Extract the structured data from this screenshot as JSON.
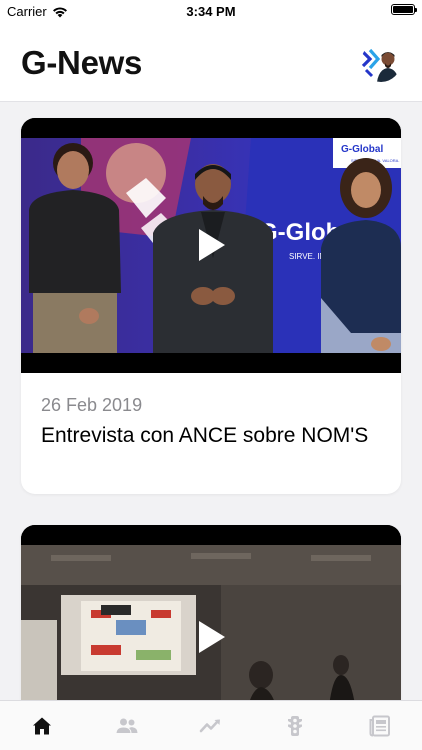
{
  "status_bar": {
    "carrier": "Carrier",
    "time": "3:34 PM"
  },
  "header": {
    "title": "G-News",
    "avatar_icon": "profile-avatar"
  },
  "feed": {
    "items": [
      {
        "type": "video",
        "date": "26 Feb 2019",
        "title": "Entrevista con ANCE sobre NOM'S",
        "thumbnail_text": {
          "brand": "G-Global",
          "brand_tag": "SIRVE. INNOVA. VALORA.",
          "banner_partial": "G-Glob",
          "banner_tag_partial": "SIRVE. INNOV"
        }
      },
      {
        "type": "video",
        "date": "",
        "title": ""
      }
    ]
  },
  "tab_bar": {
    "active_color": "#111111",
    "inactive_color": "#c7c7cc",
    "tabs": [
      {
        "icon": "home-icon",
        "active": true
      },
      {
        "icon": "people-icon",
        "active": false
      },
      {
        "icon": "trend-icon",
        "active": false
      },
      {
        "icon": "traffic-light-icon",
        "active": false
      },
      {
        "icon": "news-icon",
        "active": false
      }
    ]
  },
  "colors": {
    "brand_blue": "#2436c9",
    "brand_light_blue": "#2ba3e8"
  }
}
